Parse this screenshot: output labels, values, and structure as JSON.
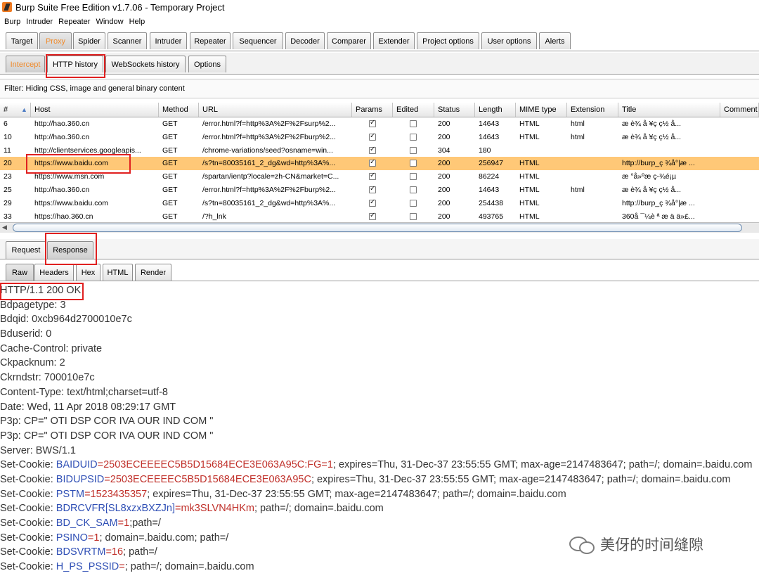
{
  "window": {
    "title": "Burp Suite Free Edition v1.7.06 - Temporary Project"
  },
  "menu": [
    "Burp",
    "Intruder",
    "Repeater",
    "Window",
    "Help"
  ],
  "main_tabs": [
    "Target",
    "Proxy",
    "Spider",
    "Scanner",
    "Intruder",
    "Repeater",
    "Sequencer",
    "Decoder",
    "Comparer",
    "Extender",
    "Project options",
    "User options",
    "Alerts"
  ],
  "proxy_tabs": [
    "Intercept",
    "HTTP history",
    "WebSockets history",
    "Options"
  ],
  "filter": "Filter: Hiding CSS, image and general binary content",
  "columns": [
    "#",
    "Host",
    "Method",
    "URL",
    "Params",
    "Edited",
    "Status",
    "Length",
    "MIME type",
    "Extension",
    "Title",
    "Comment"
  ],
  "rows": [
    {
      "num": "6",
      "host": "http://hao.360.cn",
      "method": "GET",
      "url": "/error.html?f=http%3A%2F%2Fsurp%2...",
      "params": true,
      "edited": false,
      "status": "200",
      "length": "14643",
      "mime": "HTML",
      "ext": "html",
      "title": "æ  è¾ å ¥ç  ç½ å..."
    },
    {
      "num": "10",
      "host": "http://hao.360.cn",
      "method": "GET",
      "url": "/error.html?f=http%3A%2F%2Fburp%2...",
      "params": true,
      "edited": false,
      "status": "200",
      "length": "14643",
      "mime": "HTML",
      "ext": "html",
      "title": "æ  è¾ å ¥ç  ç½ å..."
    },
    {
      "num": "11",
      "host": "http://clientservices.googleapis...",
      "method": "GET",
      "url": "/chrome-variations/seed?osname=win...",
      "params": true,
      "edited": false,
      "status": "304",
      "length": "180",
      "mime": "",
      "ext": "",
      "title": ""
    },
    {
      "num": "20",
      "host": "https://www.baidu.com",
      "method": "GET",
      "url": "/s?tn=80035161_2_dg&wd=http%3A%...",
      "params": true,
      "edited": false,
      "status": "200",
      "length": "256947",
      "mime": "HTML",
      "ext": "",
      "title": "http://burp_ç ¾å°|æ  ..."
    },
    {
      "num": "23",
      "host": "https://www.msn.com",
      "method": "GET",
      "url": "/spartan/ientp?locale=zh-CN&market=C...",
      "params": true,
      "edited": false,
      "status": "200",
      "length": "86224",
      "mime": "HTML",
      "ext": "",
      "title": "æ °å»ºæ  ç-¾é¡µ"
    },
    {
      "num": "25",
      "host": "http://hao.360.cn",
      "method": "GET",
      "url": "/error.html?f=http%3A%2F%2Fburp%2...",
      "params": true,
      "edited": false,
      "status": "200",
      "length": "14643",
      "mime": "HTML",
      "ext": "html",
      "title": "æ  è¾ å ¥ç  ç½ å..."
    },
    {
      "num": "29",
      "host": "https://www.baidu.com",
      "method": "GET",
      "url": "/s?tn=80035161_2_dg&wd=http%3A%...",
      "params": true,
      "edited": false,
      "status": "200",
      "length": "254438",
      "mime": "HTML",
      "ext": "",
      "title": "http://burp_ç ¾å°|æ  ..."
    },
    {
      "num": "33",
      "host": "https://hao.360.cn",
      "method": "GET",
      "url": "/?h_lnk",
      "params": true,
      "edited": false,
      "status": "200",
      "length": "493765",
      "mime": "HTML",
      "ext": "",
      "title": "360å ¯¼è ª æ  ä ä»£..."
    }
  ],
  "req_resp_tabs": [
    "Request",
    "Response"
  ],
  "view_tabs": [
    "Raw",
    "Headers",
    "Hex",
    "HTML",
    "Render"
  ],
  "response_lines": [
    [
      {
        "t": "HTTP/1.1 200 OK",
        "c": ""
      }
    ],
    [
      {
        "t": "Bdpagetype: 3",
        "c": ""
      }
    ],
    [
      {
        "t": "Bdqid: 0xcb964d2700010e7c",
        "c": ""
      }
    ],
    [
      {
        "t": "Bduserid: 0",
        "c": ""
      }
    ],
    [
      {
        "t": "Cache-Control: private",
        "c": ""
      }
    ],
    [
      {
        "t": "Ckpacknum: 2",
        "c": ""
      }
    ],
    [
      {
        "t": "Ckrndstr: 700010e7c",
        "c": ""
      }
    ],
    [
      {
        "t": "Content-Type: text/html;charset=utf-8",
        "c": ""
      }
    ],
    [
      {
        "t": "Date: Wed, 11 Apr 2018 08:29:17 GMT",
        "c": ""
      }
    ],
    [
      {
        "t": "P3p: CP=\" OTI DSP COR IVA OUR IND COM \"",
        "c": ""
      }
    ],
    [
      {
        "t": "P3p: CP=\" OTI DSP COR IVA OUR IND COM \"",
        "c": ""
      }
    ],
    [
      {
        "t": "Server: BWS/1.1",
        "c": ""
      }
    ],
    [
      {
        "t": "Set-Cookie: ",
        "c": ""
      },
      {
        "t": "BAIDUID",
        "c": "k"
      },
      {
        "t": "=2503ECEEEEC5B5D15684ECE3E063A95C:FG=1",
        "c": "v"
      },
      {
        "t": "; expires=Thu, 31-Dec-37 23:55:55 GMT; max-age=2147483647; path=/; domain=.baidu.com",
        "c": ""
      }
    ],
    [
      {
        "t": "Set-Cookie: ",
        "c": ""
      },
      {
        "t": "BIDUPSID",
        "c": "k"
      },
      {
        "t": "=2503ECEEEEC5B5D15684ECE3E063A95C",
        "c": "v"
      },
      {
        "t": "; expires=Thu, 31-Dec-37 23:55:55 GMT; max-age=2147483647; path=/; domain=.baidu.com",
        "c": ""
      }
    ],
    [
      {
        "t": "Set-Cookie: ",
        "c": ""
      },
      {
        "t": "PSTM",
        "c": "k"
      },
      {
        "t": "=1523435357",
        "c": "v"
      },
      {
        "t": "; expires=Thu, 31-Dec-37 23:55:55 GMT; max-age=2147483647; path=/; domain=.baidu.com",
        "c": ""
      }
    ],
    [
      {
        "t": "Set-Cookie: ",
        "c": ""
      },
      {
        "t": "BDRCVFR[SL8xzxBXZJn]",
        "c": "k"
      },
      {
        "t": "=mk3SLVN4HKm",
        "c": "v"
      },
      {
        "t": "; path=/; domain=.baidu.com",
        "c": ""
      }
    ],
    [
      {
        "t": "Set-Cookie: ",
        "c": ""
      },
      {
        "t": "BD_CK_SAM",
        "c": "k"
      },
      {
        "t": "=1",
        "c": "v"
      },
      {
        "t": ";path=/",
        "c": ""
      }
    ],
    [
      {
        "t": "Set-Cookie: ",
        "c": ""
      },
      {
        "t": "PSINO",
        "c": "k"
      },
      {
        "t": "=1",
        "c": "v"
      },
      {
        "t": "; domain=.baidu.com; path=/",
        "c": ""
      }
    ],
    [
      {
        "t": "Set-Cookie: ",
        "c": ""
      },
      {
        "t": "BDSVRTM",
        "c": "k"
      },
      {
        "t": "=16",
        "c": "v"
      },
      {
        "t": "; path=/",
        "c": ""
      }
    ],
    [
      {
        "t": "Set-Cookie: ",
        "c": ""
      },
      {
        "t": "H_PS_PSSID",
        "c": "k"
      },
      {
        "t": "=",
        "c": "v"
      },
      {
        "t": "; path=/; domain=.baidu.com",
        "c": ""
      }
    ]
  ],
  "watermark": "美伢的时间缝隙",
  "colors": {
    "accent_orange": "#f08a2a",
    "selected_row": "#ffc877",
    "highlight_red": "#e02020",
    "cookie_key": "#2f4fb5",
    "cookie_value": "#c0302a"
  }
}
